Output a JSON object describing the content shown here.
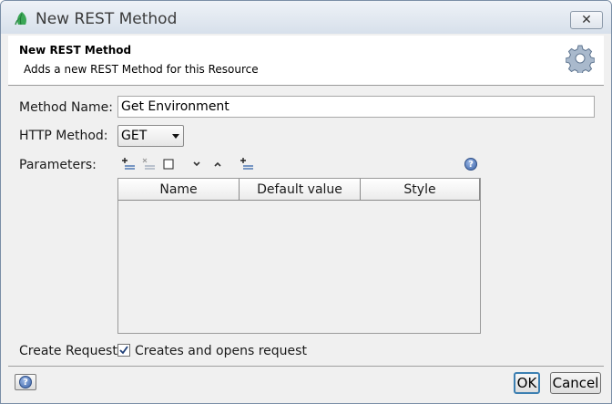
{
  "window": {
    "title": "New REST Method",
    "close_symbol": "✕"
  },
  "header": {
    "title": "New REST Method",
    "description": "Adds a new REST Method for this Resource",
    "icon": "gear-icon"
  },
  "form": {
    "method_name_label": "Method Name:",
    "method_name_value": "Get Environment",
    "http_method_label": "HTTP Method:",
    "http_method_value": "GET",
    "parameters_label": "Parameters:",
    "create_request_label": "Create Request:",
    "create_request_checkbox_label": "Creates and opens request",
    "create_request_checked": true
  },
  "toolbar": {
    "icons": [
      "add-parameter-icon",
      "remove-parameter-icon",
      "edit-parameter-icon",
      "move-down-icon",
      "move-up-icon",
      "add-from-icon",
      "help-icon"
    ]
  },
  "table": {
    "columns": [
      "Name",
      "Default value",
      "Style"
    ],
    "rows": []
  },
  "footer": {
    "help_label": "?",
    "ok_label": "OK",
    "cancel_label": "Cancel"
  },
  "colors": {
    "ok_border": "#3c7fb1",
    "help_blue": "#3c63a8"
  }
}
